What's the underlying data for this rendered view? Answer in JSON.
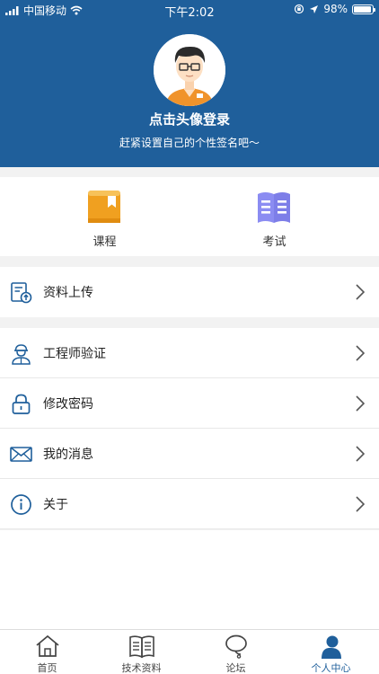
{
  "status_bar": {
    "carrier": "中国移动",
    "time": "下午2:02",
    "battery": "98%"
  },
  "profile": {
    "title": "点击头像登录",
    "signature": "赶紧设置自己的个性签名吧～"
  },
  "quick_actions": [
    {
      "label": "课程",
      "icon": "course-book-icon",
      "color": "#f0a020"
    },
    {
      "label": "考试",
      "icon": "exam-book-icon",
      "color": "#8b8cf2"
    }
  ],
  "menu": [
    {
      "label": "资料上传",
      "icon": "upload-document-icon"
    },
    {
      "label": "工程师验证",
      "icon": "engineer-icon"
    },
    {
      "label": "修改密码",
      "icon": "lock-icon"
    },
    {
      "label": "我的消息",
      "icon": "mail-icon"
    },
    {
      "label": "关于",
      "icon": "info-icon"
    }
  ],
  "tabs": [
    {
      "label": "首页",
      "icon": "home-icon"
    },
    {
      "label": "技术资料",
      "icon": "book-icon"
    },
    {
      "label": "论坛",
      "icon": "chat-bubble-icon"
    },
    {
      "label": "个人中心",
      "icon": "person-icon",
      "active": true
    }
  ],
  "colors": {
    "brand": "#1f5f9b",
    "icon_blue": "#1f5f9b",
    "background": "#f2f2f2"
  }
}
